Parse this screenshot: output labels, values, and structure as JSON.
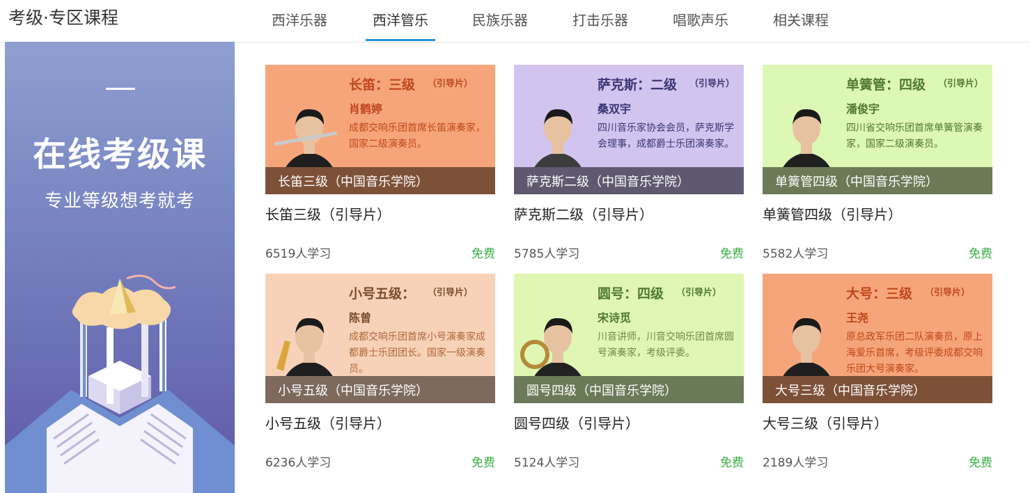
{
  "header": {
    "title": "考级·专区课程",
    "tabs": [
      {
        "label": "西洋乐器",
        "active": false
      },
      {
        "label": "西洋管乐",
        "active": true
      },
      {
        "label": "民族乐器",
        "active": false
      },
      {
        "label": "打击乐器",
        "active": false
      },
      {
        "label": "唱歌声乐",
        "active": false
      },
      {
        "label": "相关课程",
        "active": false
      }
    ],
    "accent_color": "#2596d7"
  },
  "banner": {
    "title": "在线考级课",
    "subtitle": "专业等级想考就考"
  },
  "courses": [
    {
      "thumb": {
        "name": "长笛：三级",
        "tag": "（引导片）",
        "person": "肖鹤婷",
        "desc": "成都交响乐团首席长笛演奏家，国家二级演奏员。",
        "bg": "#f6a57a",
        "text_color": "#c0461d",
        "desc_color": "#c0461d",
        "caption_bg": "#7d5138",
        "figure": "flute-player-photo"
      },
      "caption": "长笛三级（中国音乐学院）",
      "title": "长笛三级（引导片）",
      "learners": "6519人学习",
      "price": "免费"
    },
    {
      "thumb": {
        "name": "萨克斯：二级",
        "tag": "（引导片）",
        "person": "桑双宇",
        "desc": "四川音乐家协会会员，萨克斯学会理事，成都爵士乐团演奏家。",
        "bg": "#d1c5ef",
        "text_color": "#3b3573",
        "desc_color": "#3b3573",
        "caption_bg": "#5f5970",
        "figure": "saxophonist-photo"
      },
      "caption": "萨克斯二级（中国音乐学院）",
      "title": "萨克斯二级（引导片）",
      "learners": "5785人学习",
      "price": "免费"
    },
    {
      "thumb": {
        "name": "单簧管：四级",
        "tag": "（引导片）",
        "person": "潘俊宇",
        "desc": "四川省交响乐团首席单簧管演奏家，国家二级演奏员。",
        "bg": "#ddf7b5",
        "text_color": "#4f7a2d",
        "desc_color": "#4f7a2d",
        "caption_bg": "#6c7a58",
        "figure": "clarinetist-photo"
      },
      "caption": "单簧管四级（中国音乐学院）",
      "title": "单簧管四级（引导片）",
      "learners": "5582人学习",
      "price": "免费"
    },
    {
      "thumb": {
        "name": "小号五级：",
        "tag": "（引导片）",
        "person": "陈曾",
        "desc": "成都交响乐团首席小号演奏家成都爵士乐团团长。国家一级演奏员。",
        "bg": "#f7d2b8",
        "text_color": "#7a4b2d",
        "desc_color": "#b0673a",
        "caption_bg": "#7d6a5c",
        "figure": "trumpeter-photo"
      },
      "caption": "小号五级（中国音乐学院）",
      "title": "小号五级（引导片）",
      "learners": "6236人学习",
      "price": "免费"
    },
    {
      "thumb": {
        "name": "圆号：四级",
        "tag": "（引导片）",
        "person": "宋诗觅",
        "desc": "川音讲师，川音交响乐团首席圆号演奏家，考级评委。",
        "bg": "#dff7b3",
        "text_color": "#4f7a2d",
        "desc_color": "#6d8a45",
        "caption_bg": "#6b7a59",
        "figure": "horn-player-photo"
      },
      "caption": "圆号四级（中国音乐学院）",
      "title": "圆号四级（引导片）",
      "learners": "5124人学习",
      "price": "免费"
    },
    {
      "thumb": {
        "name": "大号：三级",
        "tag": "（引导片）",
        "person": "王尧",
        "desc": "原总政军乐团二队演奏员，原上海爱乐首席，考级评委成都交响乐团大号演奏家。",
        "bg": "#f6a57a",
        "text_color": "#c0461d",
        "desc_color": "#c0461d",
        "caption_bg": "#7d5138",
        "figure": "tuba-player-photo"
      },
      "caption": "大号三级（中国音乐学院）",
      "title": "大号三级（引导片）",
      "learners": "2189人学习",
      "price": "免费"
    }
  ]
}
